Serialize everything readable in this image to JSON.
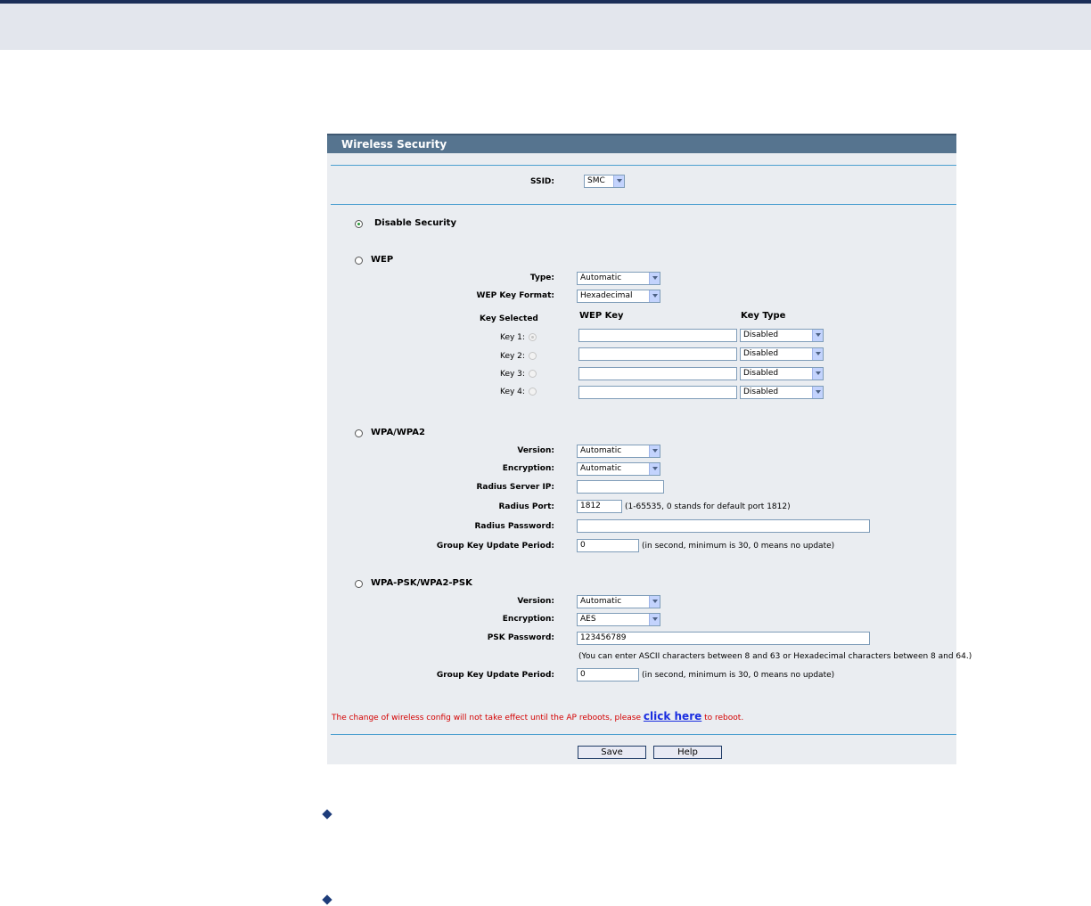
{
  "panel": {
    "title": "Wireless Security"
  },
  "ssid": {
    "label": "SSID:",
    "value": "SMC"
  },
  "disable": {
    "label": "Disable Security",
    "selected": true
  },
  "wep": {
    "label": "WEP",
    "type_label": "Type:",
    "type_value": "Automatic",
    "format_label": "WEP Key Format:",
    "format_value": "Hexadecimal",
    "key_selected_header": "Key Selected",
    "wep_key_header": "WEP Key",
    "key_type_header": "Key Type",
    "keys": [
      {
        "label": "Key 1:",
        "value": "",
        "type": "Disabled"
      },
      {
        "label": "Key 2:",
        "value": "",
        "type": "Disabled"
      },
      {
        "label": "Key 3:",
        "value": "",
        "type": "Disabled"
      },
      {
        "label": "Key 4:",
        "value": "",
        "type": "Disabled"
      }
    ]
  },
  "wpa": {
    "label": "WPA/WPA2",
    "version_label": "Version:",
    "version_value": "Automatic",
    "encryption_label": "Encryption:",
    "encryption_value": "Automatic",
    "radius_ip_label": "Radius Server IP:",
    "radius_ip_value": "",
    "radius_port_label": "Radius Port:",
    "radius_port_value": "1812",
    "radius_port_hint": "(1-65535, 0 stands for default port 1812)",
    "radius_pw_label": "Radius Password:",
    "radius_pw_value": "",
    "group_label": "Group Key Update Period:",
    "group_value": "0",
    "group_hint": "(in second, minimum is 30, 0 means no update)"
  },
  "psk": {
    "label": "WPA-PSK/WPA2-PSK",
    "version_label": "Version:",
    "version_value": "Automatic",
    "encryption_label": "Encryption:",
    "encryption_value": "AES",
    "psk_label": "PSK Password:",
    "psk_value": "123456789",
    "psk_hint": "(You can enter ASCII characters between 8 and 63 or Hexadecimal characters between 8 and 64.)",
    "group_label": "Group Key Update Period:",
    "group_value": "0",
    "group_hint": "(in second, minimum is 30, 0 means no update)"
  },
  "notice": {
    "before": "The change of wireless config will not take effect until the AP reboots, please ",
    "link": "click here",
    "after": " to reboot."
  },
  "buttons": {
    "save": "Save",
    "help": "Help"
  }
}
